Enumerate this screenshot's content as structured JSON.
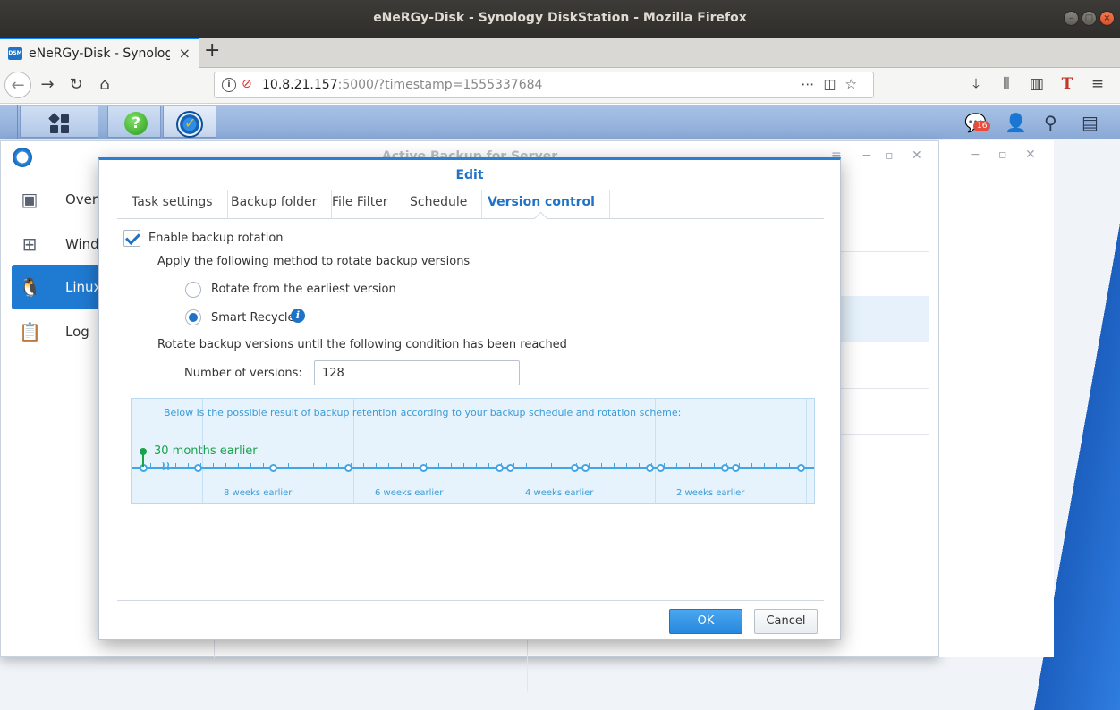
{
  "window": {
    "title": "eNeRGy-Disk - Synology DiskStation - Mozilla Firefox"
  },
  "browser": {
    "tab_title": "eNeRGy-Disk - Synology D",
    "favicon_text": "DSM",
    "url_host": "10.8.21.157",
    "url_rest": ":5000/?timestamp=1555337684"
  },
  "dsm": {
    "notification_count": "16"
  },
  "app": {
    "title": "Active Backup for Server",
    "sidebar": [
      {
        "label": "Overview",
        "icon": "overview-icon"
      },
      {
        "label": "Windows",
        "icon": "windows-icon"
      },
      {
        "label": "Linux",
        "icon": "linux-icon",
        "active": true
      },
      {
        "label": "Log",
        "icon": "log-icon"
      }
    ]
  },
  "dialog": {
    "title": "Edit",
    "tabs": [
      "Task settings",
      "Backup folder",
      "File Filter",
      "Schedule",
      "Version control"
    ],
    "active_tab": "Version control",
    "enable_rotation_label": "Enable backup rotation",
    "enable_rotation_checked": true,
    "method_label": "Apply the following method to rotate backup versions",
    "option_earliest": "Rotate from the earliest version",
    "option_smart": "Smart Recycle",
    "selected_option": "Smart Recycle",
    "condition_label": "Rotate backup versions until the following condition has been reached",
    "versions_label": "Number of versions:",
    "versions_value": "128",
    "timeline": {
      "note": "Below is the possible result of backup retention according to your backup schedule and rotation scheme:",
      "start_label": "30 months earlier",
      "weeks": [
        "8 weeks earlier",
        "6 weeks earlier",
        "4 weeks earlier",
        "2 weeks earlier"
      ]
    },
    "ok_label": "OK",
    "cancel_label": "Cancel"
  }
}
